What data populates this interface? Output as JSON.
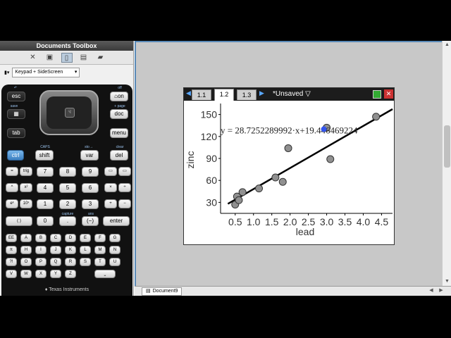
{
  "toolbox": {
    "title": "Documents Toolbox",
    "view_label": "Keypad + SideScreen"
  },
  "calculator": {
    "brand": "Texas Instruments",
    "keys": {
      "esc": "esc",
      "on": "on",
      "doc": "doc",
      "menu": "menu",
      "tab": "tab",
      "ctrl": "ctrl",
      "shift": "shift",
      "var": "var",
      "del": "del",
      "equals": "=",
      "trig": "trig",
      "seven": "7",
      "eight": "8",
      "nine": "9",
      "caret": "^",
      "square": "x²",
      "four": "4",
      "five": "5",
      "six": "6",
      "times": "×",
      "divide": "÷",
      "ex": "eˣ",
      "ten": "10ˣ",
      "one": "1",
      "two": "2",
      "three": "3",
      "plus": "+",
      "minus": "−",
      "parens": "( )",
      "zero": "0",
      "dot": ".",
      "neg": "(−)",
      "enter": "enter"
    },
    "labels": {
      "off": "off",
      "save": "save",
      "page": "+ page",
      "caps": "CAPS",
      "sto": "sto→",
      "clear": "clear",
      "capture": "capture",
      "ans": "ans"
    },
    "letters": [
      "EE",
      "A",
      "B",
      "C",
      "D",
      "E",
      "F",
      "G",
      "π",
      "H",
      "I",
      "J",
      "K",
      "L",
      "M",
      "N",
      "?!",
      "O",
      "P",
      "Q",
      "R",
      "S",
      "T",
      "U",
      "V",
      "W",
      "X",
      "Y",
      "Z"
    ]
  },
  "screen": {
    "tabs": [
      "1.1",
      "1.2",
      "1.3"
    ],
    "active_tab": "1.2",
    "doc_name": "*Unsaved"
  },
  "document_tab": "Document9",
  "chart_data": {
    "type": "scatter",
    "xlabel": "lead",
    "ylabel": "zinc",
    "xlim": [
      0.1,
      4.8
    ],
    "ylim": [
      15,
      165
    ],
    "xticks": [
      0.5,
      1.0,
      1.5,
      2.0,
      2.5,
      3.0,
      3.5,
      4.0,
      4.5
    ],
    "yticks": [
      30,
      60,
      90,
      120,
      150
    ],
    "points": [
      {
        "x": 0.5,
        "y": 27
      },
      {
        "x": 0.55,
        "y": 38
      },
      {
        "x": 0.6,
        "y": 33
      },
      {
        "x": 0.7,
        "y": 44
      },
      {
        "x": 1.15,
        "y": 49
      },
      {
        "x": 1.6,
        "y": 64
      },
      {
        "x": 1.8,
        "y": 58
      },
      {
        "x": 1.95,
        "y": 104
      },
      {
        "x": 3.0,
        "y": 132
      },
      {
        "x": 3.1,
        "y": 89
      },
      {
        "x": 4.35,
        "y": 147
      }
    ],
    "regression": {
      "slope": 28.7252289992,
      "intercept": 19.446469224
    },
    "equation": "y = 28.7252289992·x+19.446469224",
    "grid": false
  }
}
